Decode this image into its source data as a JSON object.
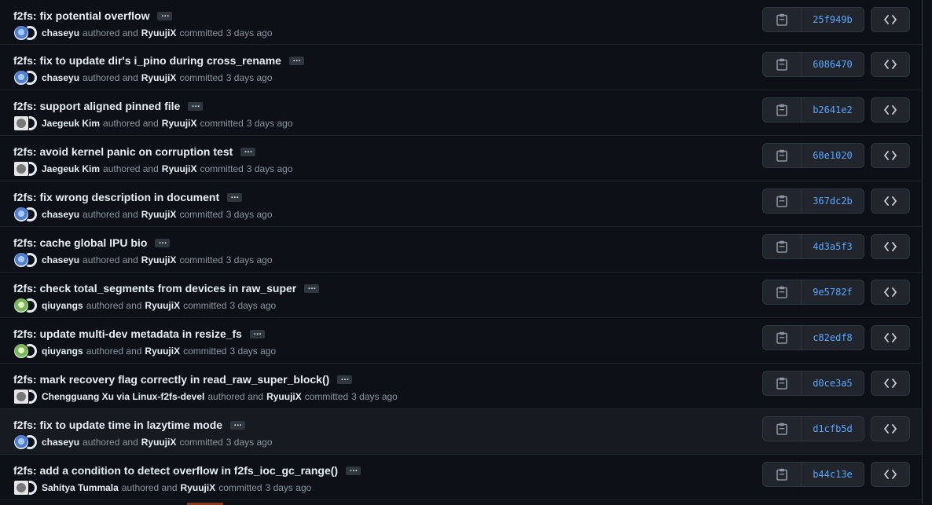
{
  "labels": {
    "authored": "authored and",
    "committed": "committed"
  },
  "commits": [
    {
      "message": "f2fs: fix potential overflow",
      "author": "chaseyu",
      "committer": "RyuujiX",
      "time": "3 days ago",
      "sha": "25f949b",
      "avatar": "blue"
    },
    {
      "message": "f2fs: fix to update dir's i_pino during cross_rename",
      "author": "chaseyu",
      "committer": "RyuujiX",
      "time": "3 days ago",
      "sha": "6086470",
      "avatar": "blue"
    },
    {
      "message": "f2fs: support aligned pinned file",
      "author": "Jaegeuk Kim",
      "committer": "RyuujiX",
      "time": "3 days ago",
      "sha": "b2641e2",
      "avatar": "gh"
    },
    {
      "message": "f2fs: avoid kernel panic on corruption test",
      "author": "Jaegeuk Kim",
      "committer": "RyuujiX",
      "time": "3 days ago",
      "sha": "68e1020",
      "avatar": "gh"
    },
    {
      "message": "f2fs: fix wrong description in document",
      "author": "chaseyu",
      "committer": "RyuujiX",
      "time": "3 days ago",
      "sha": "367dc2b",
      "avatar": "blue"
    },
    {
      "message": "f2fs: cache global IPU bio",
      "author": "chaseyu",
      "committer": "RyuujiX",
      "time": "3 days ago",
      "sha": "4d3a5f3",
      "avatar": "blue"
    },
    {
      "message": "f2fs: check total_segments from devices in raw_super",
      "author": "qiuyangs",
      "committer": "RyuujiX",
      "time": "3 days ago",
      "sha": "9e5782f",
      "avatar": "green"
    },
    {
      "message": "f2fs: update multi-dev metadata in resize_fs",
      "author": "qiuyangs",
      "committer": "RyuujiX",
      "time": "3 days ago",
      "sha": "c82edf8",
      "avatar": "green"
    },
    {
      "message": "f2fs: mark recovery flag correctly in read_raw_super_block()",
      "author": "Chengguang Xu via Linux-f2fs-devel",
      "committer": "RyuujiX",
      "time": "3 days ago",
      "sha": "d0ce3a5",
      "avatar": "gh"
    },
    {
      "message": "f2fs: fix to update time in lazytime mode",
      "author": "chaseyu",
      "committer": "RyuujiX",
      "time": "3 days ago",
      "sha": "d1cfb5d",
      "avatar": "blue",
      "hover": true
    },
    {
      "message": "f2fs: add a condition to detect overflow in f2fs_ioc_gc_range()",
      "author": "Sahitya Tummala",
      "committer": "RyuujiX",
      "time": "3 days ago",
      "sha": "b44c13e",
      "avatar": "gh"
    }
  ],
  "colors": {
    "background": "#0d1117",
    "sha_link": "#58a6ff",
    "text_muted": "#8b949e",
    "text_primary": "#e6edf3"
  },
  "icons": {
    "copy": "copy-icon",
    "browse": "code-icon",
    "more": "ellipsis-icon"
  }
}
